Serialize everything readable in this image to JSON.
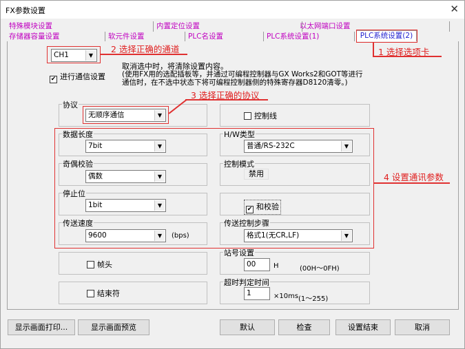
{
  "window": {
    "title": "FX参数设置",
    "close": "✕"
  },
  "tabs_row1": [
    "特殊模块设置",
    "内置定位设置",
    "以太网端口设置"
  ],
  "tabs_row2": [
    "存储器容量设置",
    "软元件设置",
    "PLC名设置",
    "PLC系统设置(1)",
    "PLC系统设置(2)"
  ],
  "channel": {
    "value": "CH1"
  },
  "comm": {
    "checkbox_label": "进行通信设置",
    "checked": "✔",
    "note_line1": "取消选中时，将清除设置内容。",
    "note_line2": "(使用FX用的选配插板等，并通过可编程控制器与GX Works2和GOT等进行",
    "note_line3": "通信时，在不选中状态下将可编程控制器侧的特殊寄存器D8120清零。)"
  },
  "protocol": {
    "label": "协议",
    "value": "无顺序通信"
  },
  "control_line": {
    "label": "控制线"
  },
  "data_length": {
    "label": "数据长度",
    "value": "7bit"
  },
  "hw_type": {
    "label": "H/W类型",
    "value": "普通/RS-232C"
  },
  "parity": {
    "label": "奇偶校验",
    "value": "偶数"
  },
  "control_mode": {
    "label": "控制模式",
    "value": "禁用"
  },
  "stop_bit": {
    "label": "停止位",
    "value": "1bit"
  },
  "checksum": {
    "label": "和校验",
    "checked": "✔"
  },
  "baud": {
    "label": "传送速度",
    "value": "9600",
    "unit": "(bps)"
  },
  "transfer_steps": {
    "label": "传送控制步骤",
    "value": "格式1(无CR,LF)"
  },
  "header": {
    "label": "帧头"
  },
  "station": {
    "label": "站号设置",
    "value": "00",
    "unit": "H",
    "range": "(00H～0FH)"
  },
  "terminator": {
    "label": "结束符"
  },
  "timeout": {
    "label": "超时判定时间",
    "value": "1",
    "unit": "×10ms",
    "range": "(1～255)"
  },
  "buttons": {
    "print": "显示画面打印...",
    "preview": "显示画面预览",
    "default": "默认",
    "check": "检查",
    "finish": "设置结束",
    "cancel": "取消"
  },
  "annotations": {
    "a1": "1 选择选项卡",
    "a2": "2 选择正确的通道",
    "a3": "3 选择正确的协议",
    "a4": "4 设置通讯参数",
    "accent_color": "#e02020"
  },
  "icons": {
    "dropdown": "chevron-down-icon",
    "close": "close-icon"
  }
}
